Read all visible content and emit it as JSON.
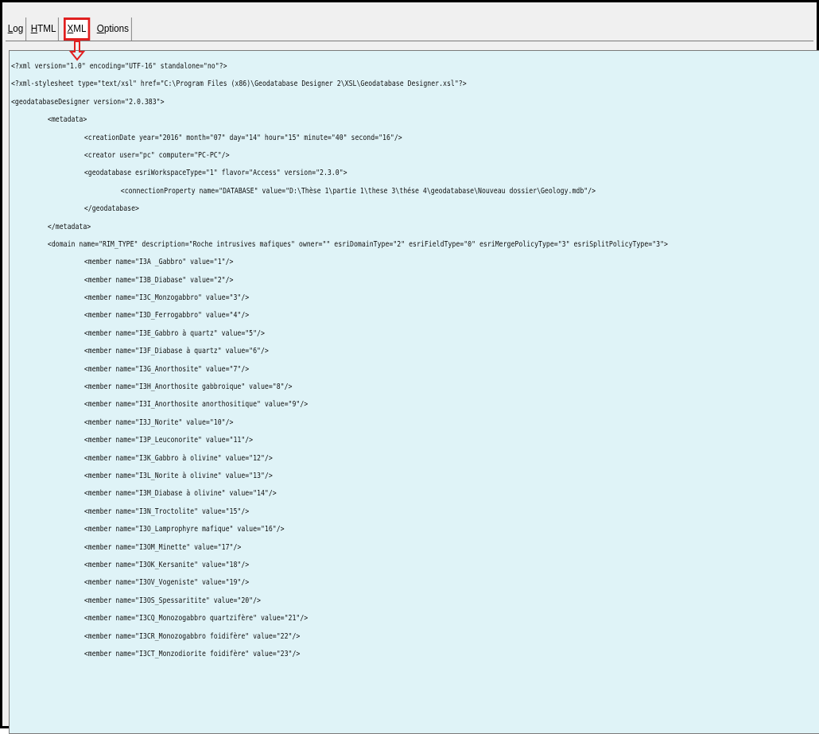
{
  "tabs": [
    {
      "label": "Log",
      "u": "L",
      "rest": "og",
      "active": false
    },
    {
      "label": "HTML",
      "u": "H",
      "rest": "TML",
      "active": false
    },
    {
      "label": "XML",
      "u": "X",
      "rest": "ML",
      "active": true
    },
    {
      "label": "Options",
      "u": "O",
      "rest": "ptions",
      "active": false
    }
  ],
  "colors": {
    "highlight": "#e02020",
    "content_bg": "#dff3f7"
  },
  "xml_lines": [
    {
      "indent": 0,
      "text": "<?xml version=\"1.0\" encoding=\"UTF-16\" standalone=\"no\"?>"
    },
    {
      "indent": 0,
      "text": "<?xml-stylesheet type=\"text/xsl\" href=\"C:\\Program Files (x86)\\Geodatabase Designer 2\\XSL\\Geodatabase Designer.xsl\"?>"
    },
    {
      "indent": 0,
      "text": "<geodatabaseDesigner version=\"2.0.383\">"
    },
    {
      "indent": 1,
      "text": "<metadata>"
    },
    {
      "indent": 2,
      "text": "<creationDate year=\"2016\" month=\"07\" day=\"14\" hour=\"15\" minute=\"40\" second=\"16\"/>"
    },
    {
      "indent": 2,
      "text": "<creator user=\"pc\" computer=\"PC-PC\"/>"
    },
    {
      "indent": 2,
      "text": "<geodatabase esriWorkspaceType=\"1\" flavor=\"Access\" version=\"2.3.0\">"
    },
    {
      "indent": 3,
      "text": "<connectionProperty name=\"DATABASE\" value=\"D:\\Thèse 1\\partie 1\\these 3\\thése 4\\geodatabase\\Nouveau dossier\\Geology.mdb\"/>"
    },
    {
      "indent": 2,
      "text": "</geodatabase>"
    },
    {
      "indent": 1,
      "text": "</metadata>"
    },
    {
      "indent": 1,
      "text": "<domain name=\"RIM_TYPE\" description=\"Roche intrusives mafiques\" owner=\"\" esriDomainType=\"2\" esriFieldType=\"0\" esriMergePolicyType=\"3\" esriSplitPolicyType=\"3\">"
    },
    {
      "indent": 2,
      "text": "<member name=\"I3A _Gabbro\" value=\"1\"/>"
    },
    {
      "indent": 2,
      "text": "<member name=\"I3B_Diabase\" value=\"2\"/>"
    },
    {
      "indent": 2,
      "text": "<member name=\"I3C_Monzogabbro\" value=\"3\"/>"
    },
    {
      "indent": 2,
      "text": "<member name=\"I3D_Ferrogabbro\" value=\"4\"/>"
    },
    {
      "indent": 2,
      "text": "<member name=\"I3E_Gabbro à quartz\" value=\"5\"/>"
    },
    {
      "indent": 2,
      "text": "<member name=\"I3F_Diabase à quartz\" value=\"6\"/>"
    },
    {
      "indent": 2,
      "text": "<member name=\"I3G_Anorthosite\" value=\"7\"/>"
    },
    {
      "indent": 2,
      "text": "<member name=\"I3H_Anorthosite gabbroique\" value=\"8\"/>"
    },
    {
      "indent": 2,
      "text": "<member name=\"I3I_Anorthosite anorthositique\" value=\"9\"/>"
    },
    {
      "indent": 2,
      "text": "<member name=\"I3J_Norite\" value=\"10\"/>"
    },
    {
      "indent": 2,
      "text": "<member name=\"I3P_Leuconorite\" value=\"11\"/>"
    },
    {
      "indent": 2,
      "text": "<member name=\"I3K_Gabbro à olivine\" value=\"12\"/>"
    },
    {
      "indent": 2,
      "text": "<member name=\"I3L_Norite à olivine\" value=\"13\"/>"
    },
    {
      "indent": 2,
      "text": "<member name=\"I3M_Diabase à olivine\" value=\"14\"/>"
    },
    {
      "indent": 2,
      "text": "<member name=\"I3N_Troctolite\" value=\"15\"/>"
    },
    {
      "indent": 2,
      "text": "<member name=\"I3O_Lamprophyre mafique\" value=\"16\"/>"
    },
    {
      "indent": 2,
      "text": "<member name=\"I3OM_Minette\" value=\"17\"/>"
    },
    {
      "indent": 2,
      "text": "<member name=\"I3OK_Kersanite\" value=\"18\"/>"
    },
    {
      "indent": 2,
      "text": "<member name=\"I3OV_Vogeniste\" value=\"19\"/>"
    },
    {
      "indent": 2,
      "text": "<member name=\"I3OS_Spessaritite\" value=\"20\"/>"
    },
    {
      "indent": 2,
      "text": "<member name=\"I3CQ_Monozogabbro quartzifère\" value=\"21\"/>"
    },
    {
      "indent": 2,
      "text": "<member name=\"I3CR_Monozogabbro foidifère\" value=\"22\"/>"
    },
    {
      "indent": 2,
      "text": "<member name=\"I3CT_Monzodiorite foidifère\" value=\"23\"/>"
    }
  ]
}
